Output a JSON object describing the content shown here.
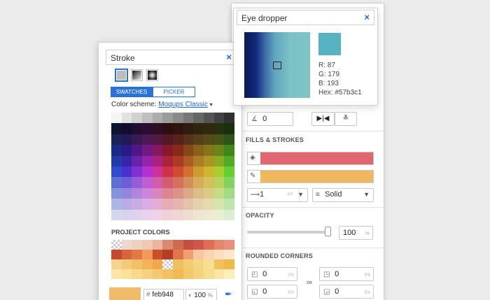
{
  "inspector": {
    "angle_value": "0",
    "fills_heading": "FILLS & STROKES",
    "fill_color": "#e06670",
    "stroke_color": "#f0b85c",
    "stroke_width": "1",
    "stroke_width_unit": "PT",
    "stroke_style": "Solid",
    "opacity_heading": "OPACITY",
    "opacity_value": "100",
    "opacity_unit": "%",
    "rounded_heading": "ROUNDED CORNERS",
    "corner_tl": "0",
    "corner_tr": "0",
    "corner_bl": "0",
    "corner_br": "0",
    "corner_unit": "PX"
  },
  "stroke_panel": {
    "title": "Stroke",
    "close": "×",
    "tab_swatches": "SWATCHES",
    "tab_picker": "PICKER",
    "scheme_label": "Color scheme:",
    "scheme_link": "Moqups Classic",
    "scheme_caret": "▾",
    "project_colors_heading": "PROJECT COLORS",
    "hex_prefix": "#",
    "hex_value": "feb948",
    "current_color": "#f0bc6c",
    "opacity_value": "100",
    "opacity_unit": "%"
  },
  "dropper": {
    "title": "Eye dropper",
    "close": "×",
    "sample_color": "#57b3c1",
    "r": "R: 87",
    "g": "G: 179",
    "b": "B: 193",
    "hex": "Hex: #57b3c1"
  }
}
